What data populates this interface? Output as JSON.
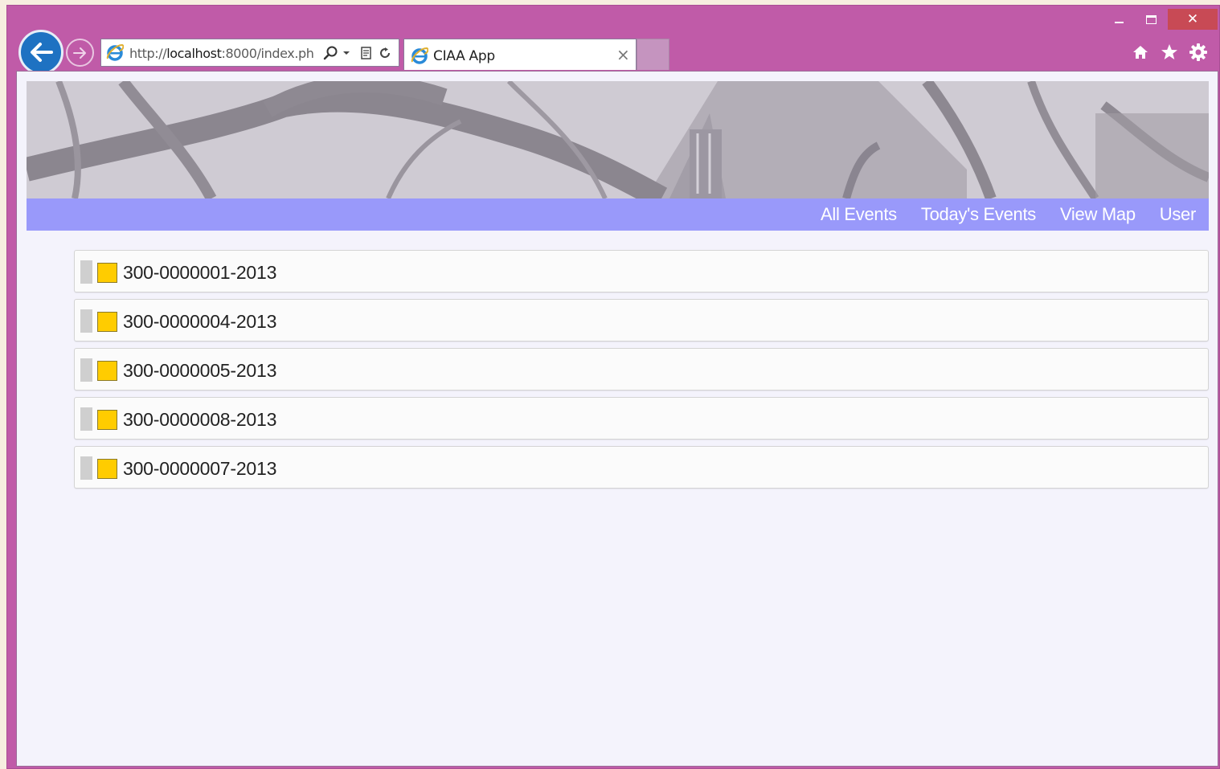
{
  "browser": {
    "address_url_prefix": "http://",
    "address_url_host": "localhost",
    "address_url_rest": ":8000/index.ph",
    "tab_title": "CIAA App",
    "tab_close_glyph": "×",
    "close_glyph": "✕",
    "icons": [
      "back-arrow-icon",
      "forward-arrow-icon",
      "ie-logo-icon",
      "search-icon",
      "dropdown-icon",
      "compat-view-icon",
      "refresh-icon",
      "close-icon",
      "home-icon",
      "favorites-star-icon",
      "settings-gear-icon",
      "minimize-icon",
      "maximize-icon"
    ]
  },
  "nav": {
    "items": [
      "All Events",
      "Today's Events",
      "View Map",
      "User"
    ]
  },
  "events": [
    {
      "id": "300-0000001-2013",
      "status_color": "#ffcc00"
    },
    {
      "id": "300-0000004-2013",
      "status_color": "#ffcc00"
    },
    {
      "id": "300-0000005-2013",
      "status_color": "#ffcc00"
    },
    {
      "id": "300-0000008-2013",
      "status_color": "#ffcc00"
    },
    {
      "id": "300-0000007-2013",
      "status_color": "#ffcc00"
    }
  ],
  "colors": {
    "window_frame": "#c05ba8",
    "navbar": "#9999fa",
    "close_button": "#c84a55",
    "page_background": "#f4f3fc"
  }
}
